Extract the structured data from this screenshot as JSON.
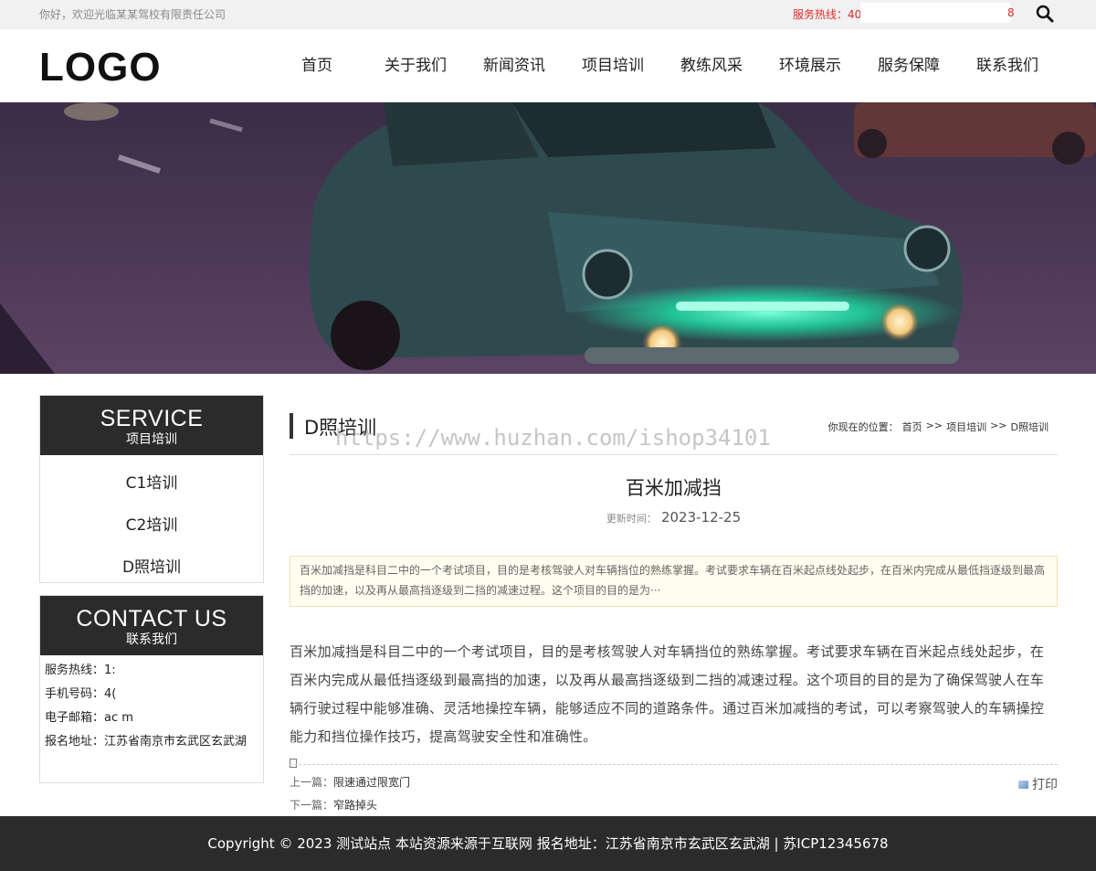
{
  "topbar": {
    "welcome": "你好，欢迎光临某某驾校有限责任公司",
    "hotline_label": "服务热线：40",
    "hotline_tail": "8"
  },
  "header": {
    "logo": "LOGO",
    "nav": [
      "首页",
      "关于我们",
      "新闻资讯",
      "项目培训",
      "教练风采",
      "环境展示",
      "服务保障",
      "联系我们"
    ]
  },
  "sidebar": {
    "service": {
      "title_en": "SERVICE",
      "title_cn": "项目培训",
      "items": [
        "C1培训",
        "C2培训",
        "D照培训"
      ]
    },
    "contact": {
      "title_en": "CONTACT US",
      "title_cn": "联系我们",
      "lines": [
        "服务热线：1:",
        "手机号码：4(",
        "电子邮箱：ac                          m",
        "报名地址：江苏省南京市玄武区玄武湖"
      ]
    }
  },
  "content": {
    "category": "D照培训",
    "watermark": "https://www.huzhan.com/ishop34101",
    "breadcrumb": {
      "prefix": "你现在的位置：",
      "home": "首页",
      "sep": ">>",
      "level1": "项目培训",
      "level2": "D照培训"
    },
    "article": {
      "title": "百米加减挡",
      "date_label": "更新时间：",
      "date": "2023-12-25",
      "summary": "百米加减挡是科目二中的一个考试项目，目的是考核驾驶人对车辆挡位的熟练掌握。考试要求车辆在百米起点线处起步，在百米内完成从最低挡逐级到最高挡的加速，以及再从最高挡逐级到二挡的减速过程。这个项目的目的是为···",
      "body": "百米加减挡是科目二中的一个考试项目，目的是考核驾驶人对车辆挡位的熟练掌握。考试要求车辆在百米起点线处起步，在百米内完成从最低挡逐级到最高挡的加速，以及再从最高挡逐级到二挡的减速过程。这个项目的目的是为了确保驾驶人在车辆行驶过程中能够准确、灵活地操控车辆，能够适应不同的道路条件。通过百米加减挡的考试，可以考察驾驶人的车辆操控能力和挡位操作技巧，提高驾驶安全性和准确性。"
    },
    "prev_label": "上一篇：",
    "prev_title": "限速通过限宽门",
    "next_label": "下一篇：",
    "next_title": "窄路掉头",
    "print_label": "打印"
  },
  "footer": {
    "text": "Copyright © 2023 测试站点 本站资源来源于互联网  报名地址：江苏省南京市玄武区玄武湖 | 苏ICP12345678"
  }
}
